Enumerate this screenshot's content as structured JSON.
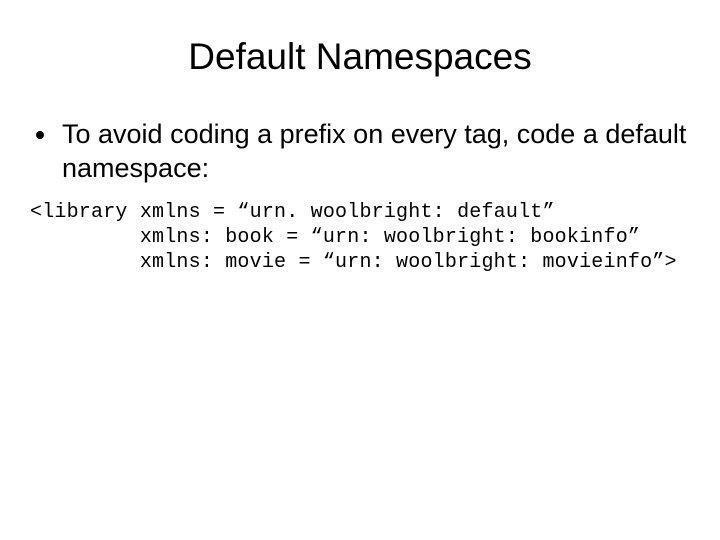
{
  "title": "Default Namespaces",
  "bullet1": "To avoid coding a prefix on every tag, code a default namespace:",
  "code_line1": "<library xmlns = “urn. woolbright: default”",
  "code_line2": "         xmlns: book = “urn: woolbright: bookinfo”",
  "code_line3": "         xmlns: movie = “urn: woolbright: movieinfo”>"
}
